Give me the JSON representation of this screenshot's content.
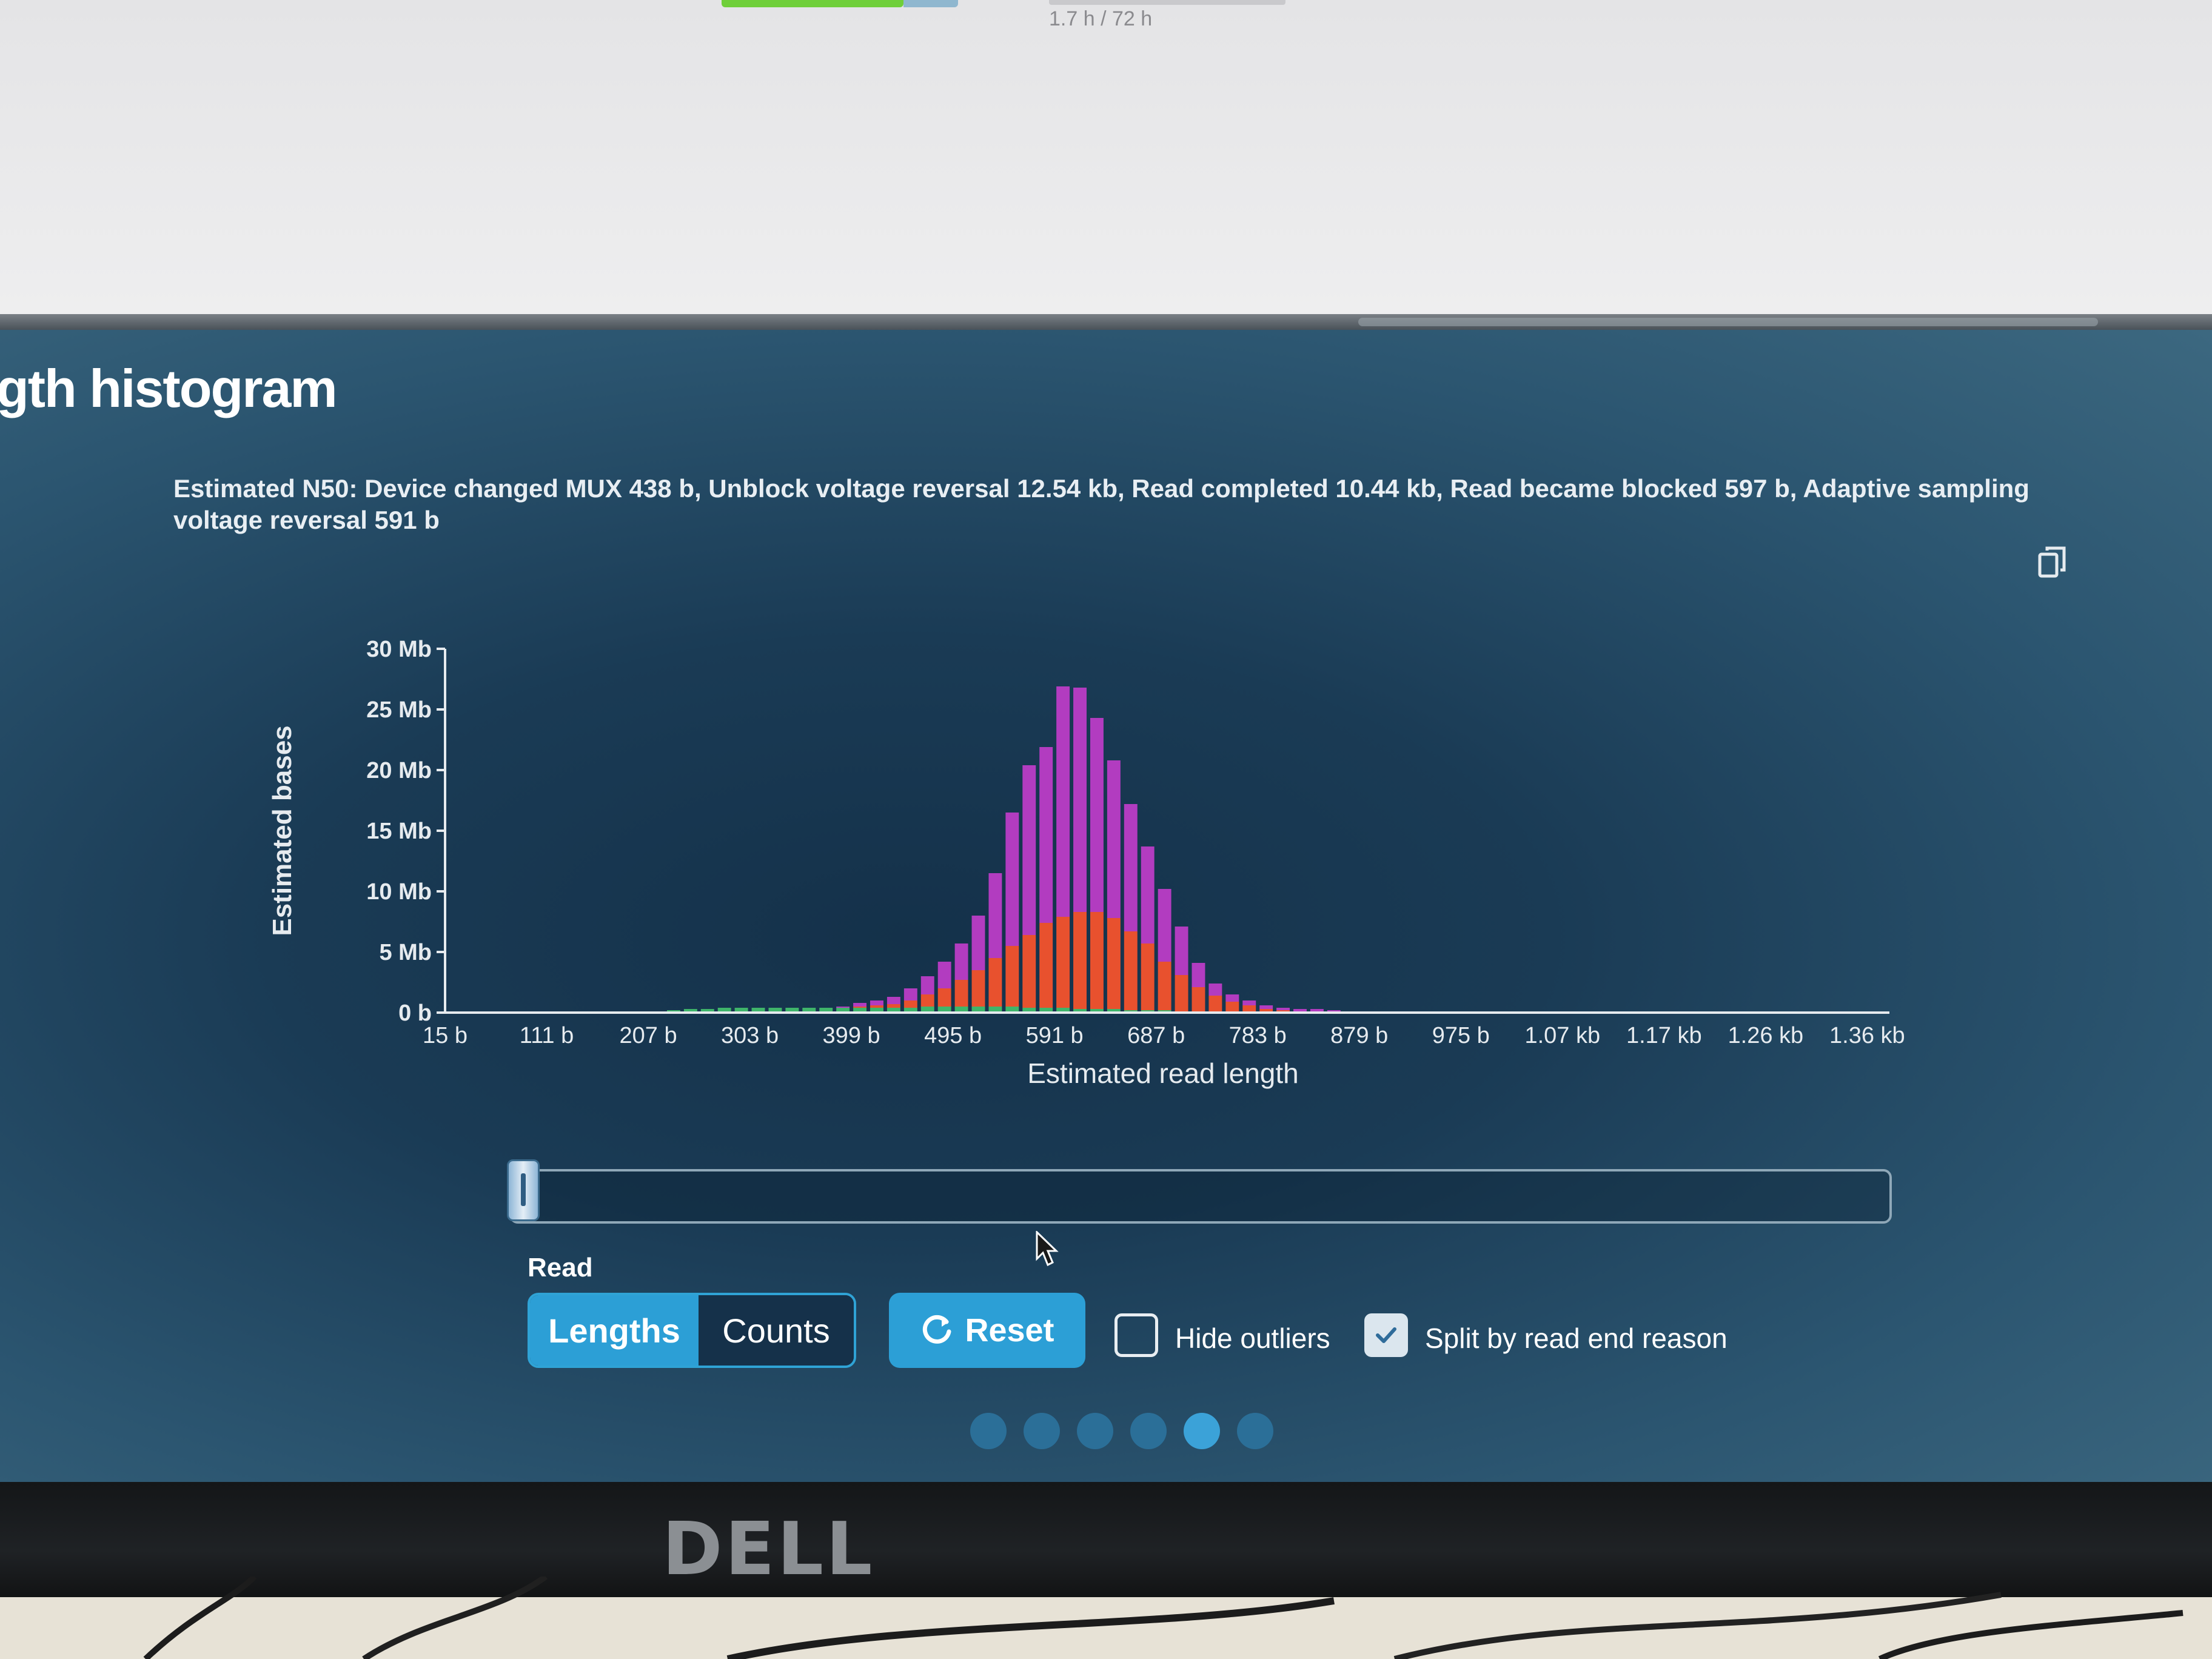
{
  "top_bar": {
    "run_time": "1.7 h / 72 h"
  },
  "panel": {
    "title": "gth histogram",
    "n50_text": "Estimated N50: Device changed MUX 438 b, Unblock voltage reversal 12.54 kb, Read completed 10.44 kb, Read became blocked 597 b, Adaptive sampling voltage reversal 591 b",
    "copy_icon": "copy-icon"
  },
  "chart_data": {
    "type": "bar",
    "stacked": true,
    "xlabel": "Estimated read length",
    "ylabel": "Estimated bases",
    "ylim": [
      0,
      30
    ],
    "y_ticks": [
      "0 b",
      "5 Mb",
      "10 Mb",
      "15 Mb",
      "20 Mb",
      "25 Mb",
      "30 Mb"
    ],
    "x_ticks": [
      "15 b",
      "111 b",
      "207 b",
      "303 b",
      "399 b",
      "495 b",
      "591 b",
      "687 b",
      "783 b",
      "879 b",
      "975 b",
      "1.07 kb",
      "1.17 kb",
      "1.26 kb",
      "1.36 kb"
    ],
    "x_range": [
      15,
      1380
    ],
    "bin_width": 16,
    "bin_starts": [
      15,
      31,
      47,
      63,
      79,
      95,
      111,
      127,
      143,
      159,
      175,
      191,
      207,
      223,
      239,
      255,
      271,
      287,
      303,
      319,
      335,
      351,
      367,
      383,
      399,
      415,
      431,
      447,
      463,
      479,
      495,
      511,
      527,
      543,
      559,
      575,
      591,
      607,
      623,
      639,
      655,
      671,
      687,
      703,
      719,
      735,
      751,
      767,
      783,
      799,
      815,
      831,
      847,
      863,
      879,
      895,
      911,
      927,
      943,
      959,
      975
    ],
    "series": [
      {
        "color": "#3fb56a",
        "values": [
          0,
          0,
          0,
          0,
          0,
          0,
          0,
          0,
          0,
          0,
          0,
          0,
          0.1,
          0.2,
          0.3,
          0.3,
          0.4,
          0.4,
          0.4,
          0.4,
          0.4,
          0.4,
          0.4,
          0.4,
          0.4,
          0.4,
          0.4,
          0.4,
          0.5,
          0.5,
          0.5,
          0.5,
          0.5,
          0.5,
          0.4,
          0.4,
          0.4,
          0.3,
          0.3,
          0.3,
          0.2,
          0.2,
          0.2,
          0.1,
          0.1,
          0.1,
          0.1,
          0.1,
          0,
          0,
          0,
          0,
          0,
          0,
          0,
          0,
          0,
          0,
          0,
          0,
          0
        ]
      },
      {
        "color": "#e8512e",
        "values": [
          0,
          0,
          0,
          0,
          0,
          0,
          0,
          0,
          0,
          0,
          0,
          0,
          0,
          0,
          0,
          0,
          0,
          0,
          0,
          0,
          0,
          0,
          0,
          0,
          0.1,
          0.2,
          0.3,
          0.6,
          1.0,
          1.5,
          2.2,
          3.0,
          4.0,
          5.0,
          6.0,
          7.0,
          7.5,
          8.0,
          8.0,
          7.5,
          6.5,
          5.5,
          4.0,
          3.0,
          2.0,
          1.3,
          0.8,
          0.5,
          0.3,
          0.2,
          0.1,
          0.1,
          0,
          0,
          0,
          0,
          0,
          0,
          0,
          0,
          0
        ]
      },
      {
        "color": "#b23cc0",
        "values": [
          0,
          0,
          0,
          0,
          0,
          0,
          0,
          0,
          0,
          0,
          0,
          0,
          0,
          0,
          0,
          0,
          0,
          0,
          0,
          0,
          0,
          0,
          0,
          0.1,
          0.3,
          0.4,
          0.6,
          1.0,
          1.5,
          2.2,
          3.0,
          4.5,
          7.0,
          11.0,
          14.0,
          14.5,
          19.0,
          18.5,
          16.0,
          13.0,
          10.5,
          8.0,
          6.0,
          4.0,
          2.0,
          1.0,
          0.6,
          0.4,
          0.3,
          0.2,
          0.2,
          0.2,
          0.2,
          0.1,
          0.1,
          0.1,
          0.1,
          0,
          0,
          0,
          0
        ]
      }
    ]
  },
  "controls": {
    "read_label": "Read",
    "lengths_label": "Lengths",
    "counts_label": "Counts",
    "reset_label": "Reset",
    "hide_outliers_label": "Hide outliers",
    "hide_outliers_checked": false,
    "split_label": "Split by read end reason",
    "split_checked": true,
    "selected_mode": "Lengths",
    "pager_dots": 6,
    "pager_active_index": 4
  },
  "monitor": {
    "brand": "DELL"
  }
}
